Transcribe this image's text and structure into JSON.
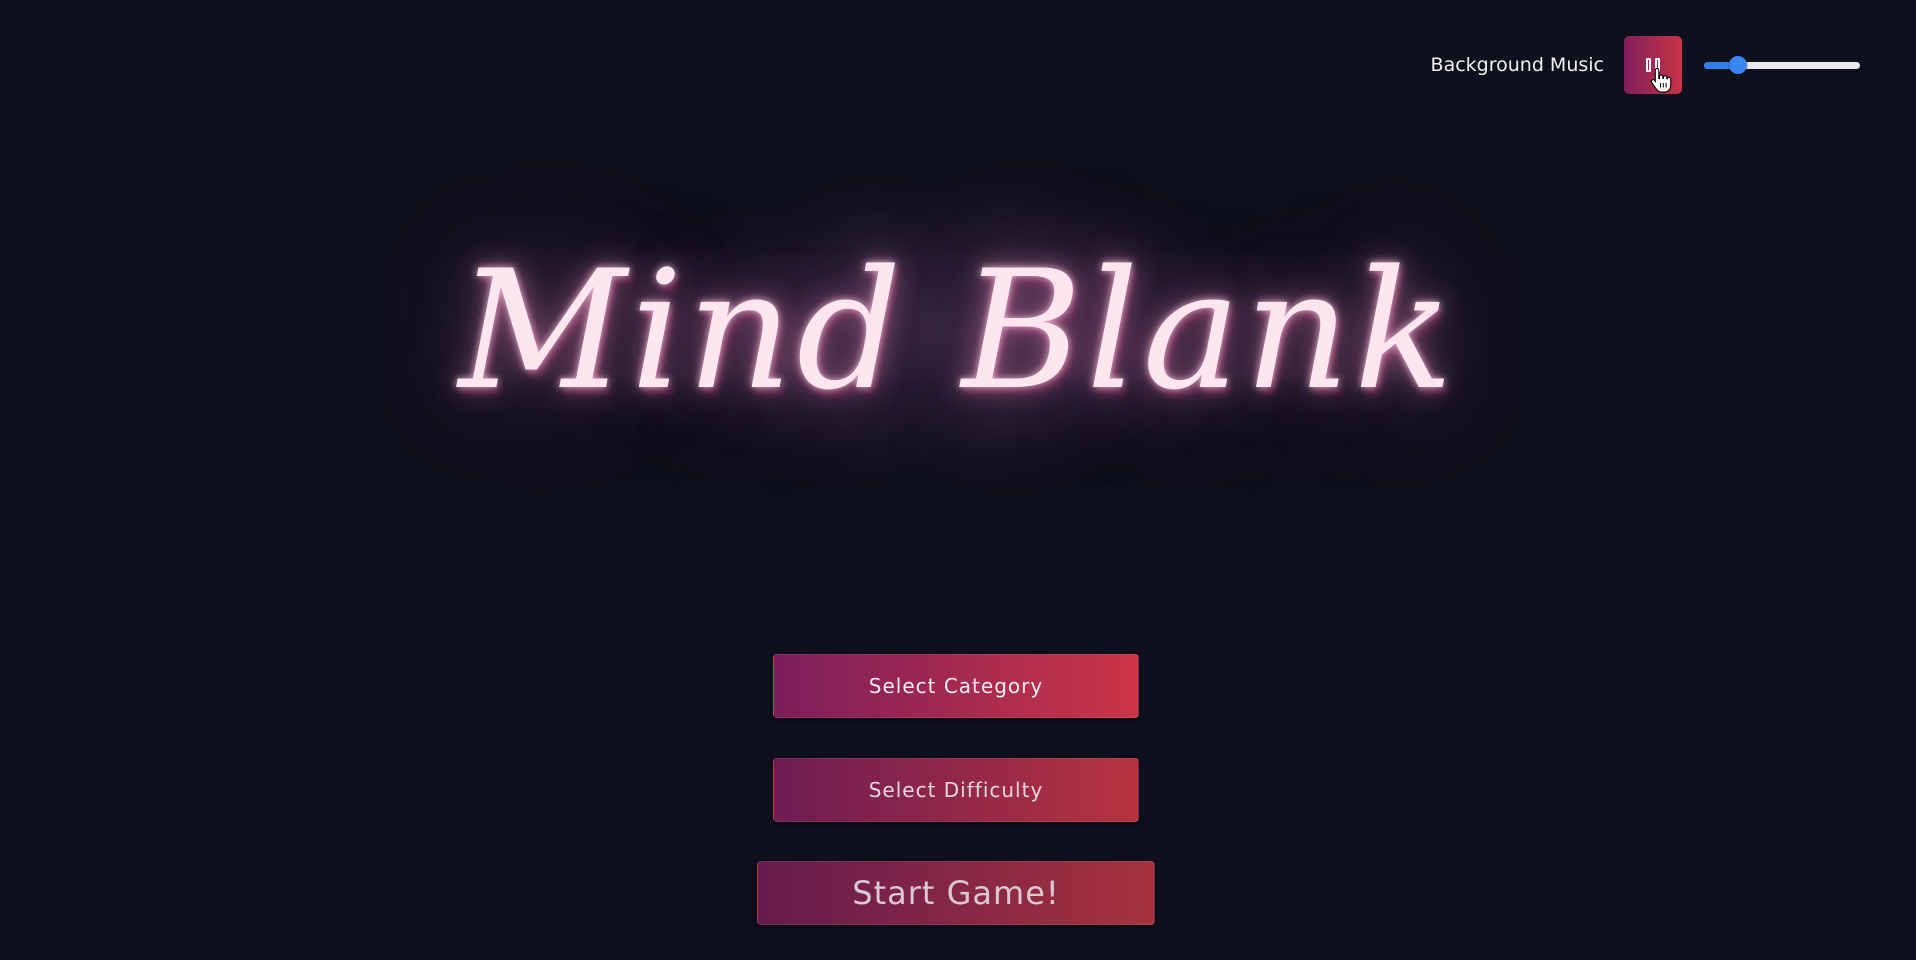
{
  "header": {
    "music_label": "Background Music",
    "pause_button": {
      "icon": "pause-icon",
      "state": "playing"
    },
    "volume": {
      "value": 0.22,
      "accent": "#2f7fee"
    }
  },
  "title": "Mind Blank",
  "menu": {
    "category_label": "Select Category",
    "difficulty_label": "Select Difficulty",
    "start_label": "Start Game!"
  },
  "colors": {
    "background": "#0f101d",
    "button_gradient_start": "#7b1e5b",
    "button_gradient_end": "#cc3546",
    "title_glow": "#fde6ee"
  }
}
